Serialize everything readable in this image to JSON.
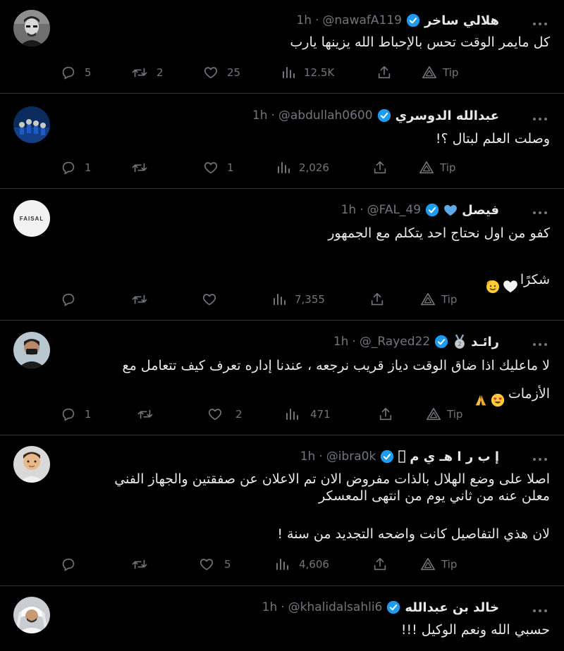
{
  "tweets": [
    {
      "name": "هلالي ساخر",
      "handle": "@nawafA119",
      "time": "1h",
      "text": "كل مايمر الوقت تحس بالإحباط الله يزينها يارب",
      "replies": "5",
      "retweets": "2",
      "likes": "25",
      "views": "12.5K",
      "tip": "Tip"
    },
    {
      "name": "عبدالله الدوسري",
      "handle": "@abdullah0600",
      "time": "1h",
      "text": "وصلت العلم لبتال ؟!",
      "replies": "1",
      "retweets": "",
      "likes": "1",
      "views": "2,026",
      "tip": "Tip"
    },
    {
      "name": "فيصل",
      "handle": "@FAL_49",
      "time": "1h",
      "avatar_text": "FAISAL",
      "text": "كفو من اول نحتاج احد يتكلم مع الجمهور",
      "text2": "شكرًا",
      "replies": "",
      "retweets": "",
      "likes": "",
      "views": "7,355",
      "tip": "Tip"
    },
    {
      "name": "رائـد",
      "handle": "@_Rayed22",
      "time": "1h",
      "text": "لا ماعليك اذا ضاق الوقت دياز قريب نرجعه ، عندنا إداره تعرف كيف تتعامل مع",
      "text2": "الأزمات",
      "replies": "1",
      "retweets": "",
      "likes": "2",
      "views": "471",
      "tip": "Tip"
    },
    {
      "name": "إ ب ر ا هـ ي م",
      "handle": "@ibra0k",
      "time": "1h",
      "text": "اصلا على وضع الهلال بالذات مفروض الان تم الاعلان عن صفقتين والجهاز الفني\nمعلن عنه من ثاني يوم من انتهى المعسكر",
      "text2": "لان هذي التفاصيل كانت واضحه التجديد من سنة !",
      "replies": "",
      "retweets": "",
      "likes": "5",
      "views": "4,606",
      "tip": "Tip"
    },
    {
      "name": "خالد بن عبدالله",
      "handle": "@khalidalsahli6",
      "time": "1h",
      "text": "حسبي الله ونعم الوكيل !!!"
    }
  ],
  "colors": {
    "background": "#000000",
    "verified": "#1d9bf0",
    "muted": "#71767b",
    "divider": "#2f3336",
    "text": "#e7e9ea"
  }
}
